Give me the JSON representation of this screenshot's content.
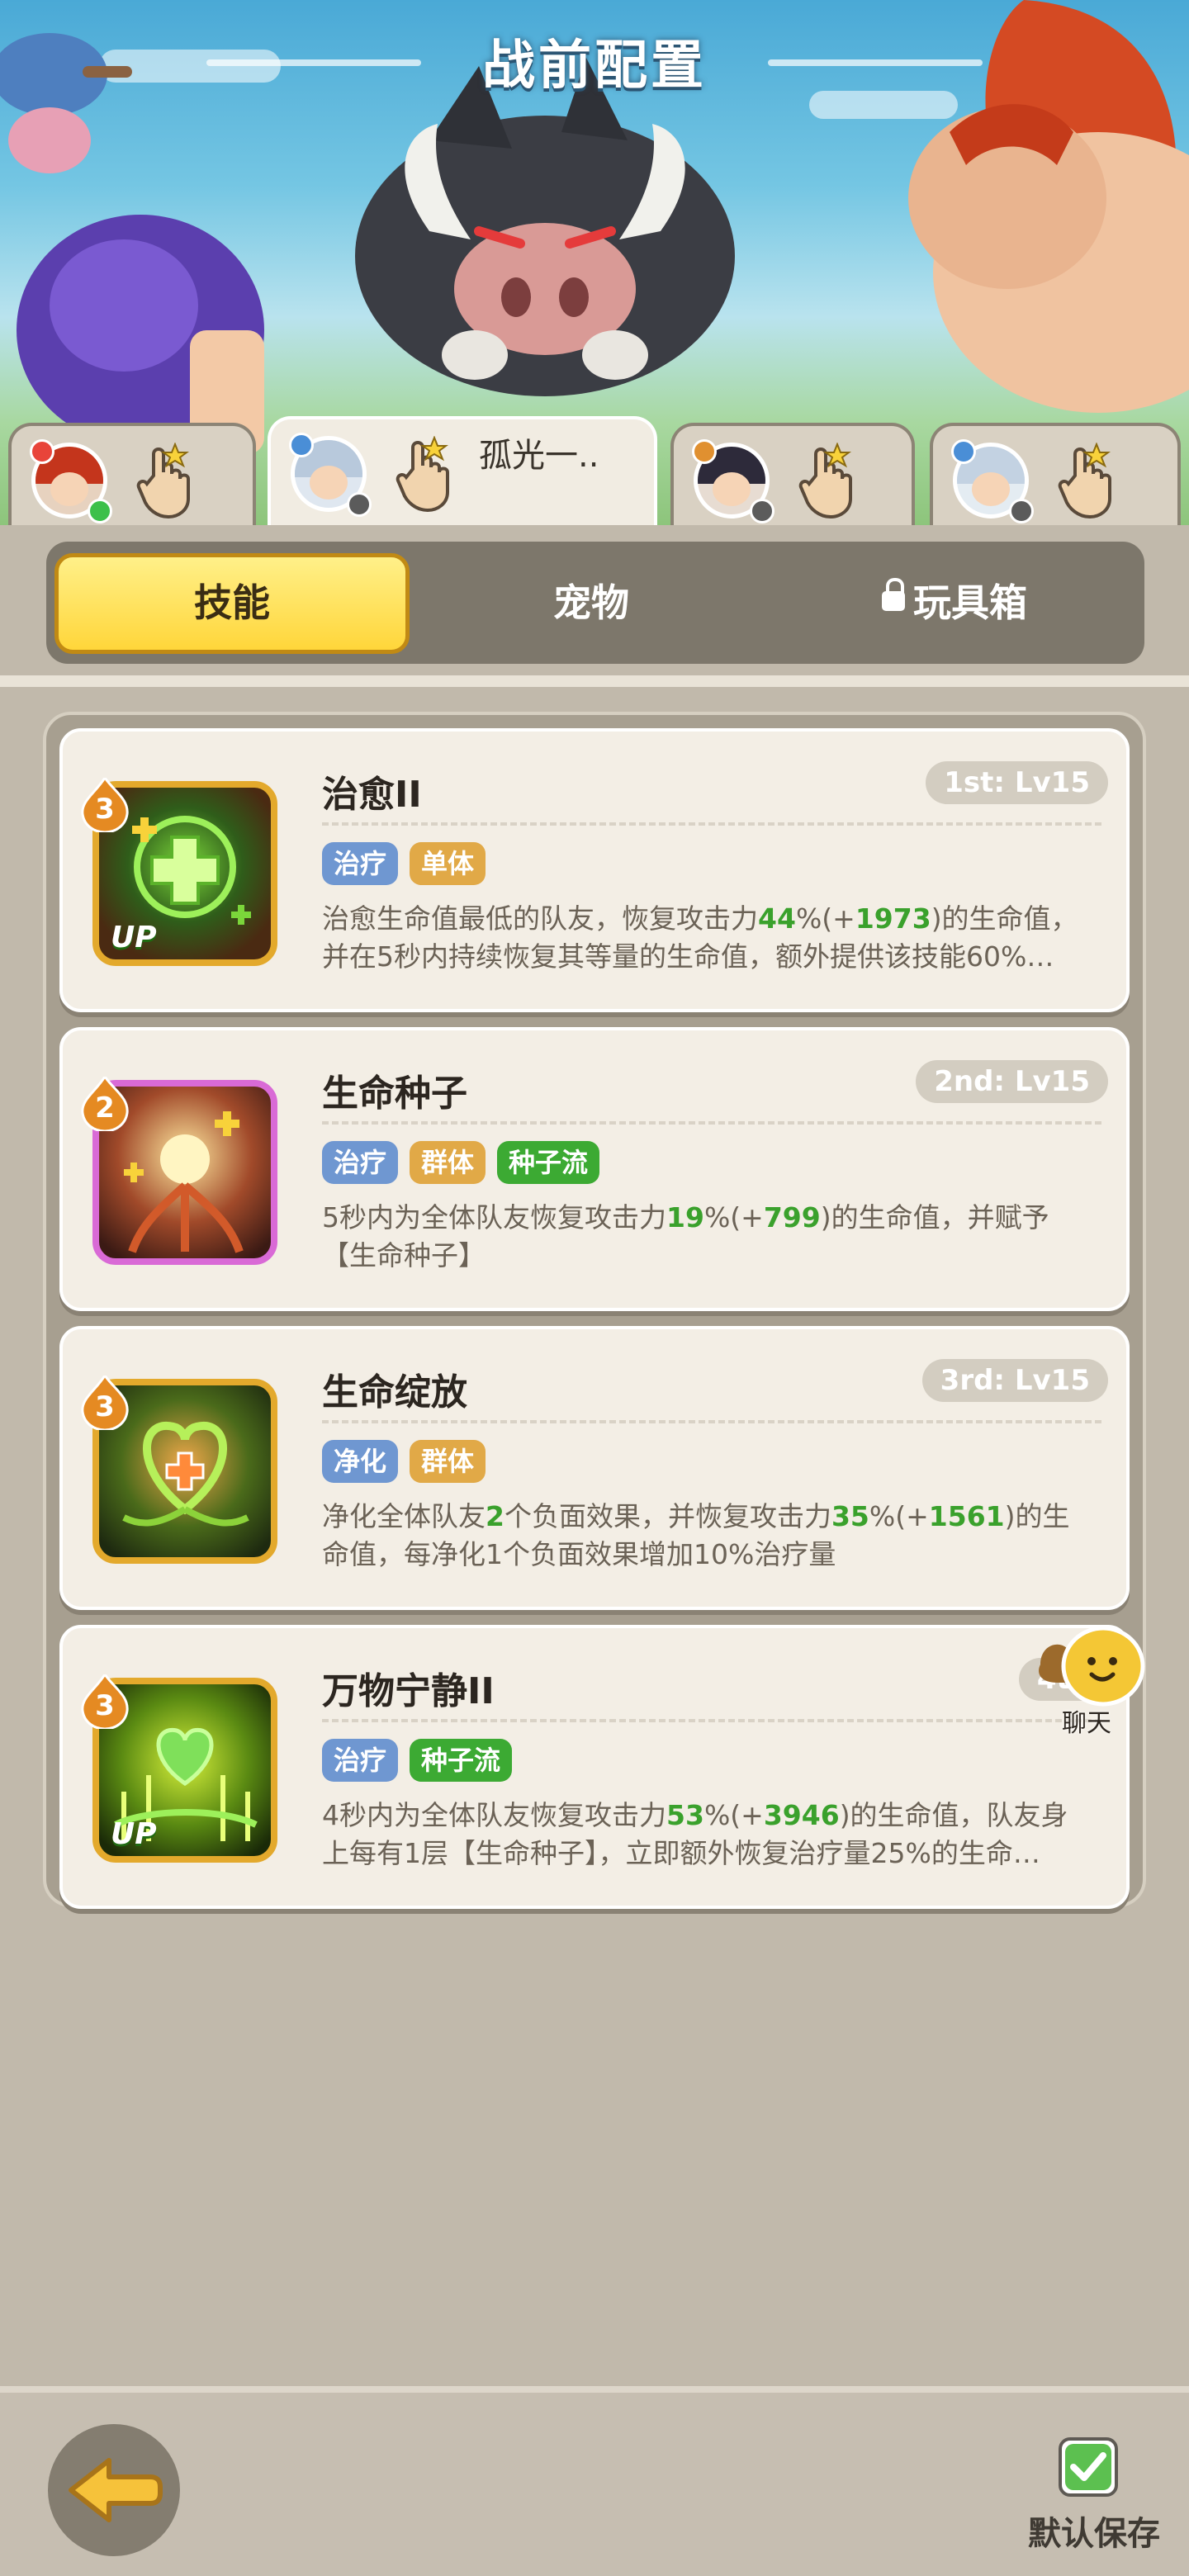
{
  "header": {
    "title": "战前配置"
  },
  "hero_tabs": [
    {
      "name": "",
      "badge_color": "#e8443a"
    },
    {
      "name": "孤光一..",
      "badge_color": "#4a8ed6"
    },
    {
      "name": "",
      "badge_color": "#e09030"
    },
    {
      "name": "",
      "badge_color": "#4a8ed6"
    }
  ],
  "tabs": {
    "skills": "技能",
    "pets": "宠物",
    "toybox": "玩具箱"
  },
  "skills": [
    {
      "rank": "3",
      "name": "治愈II",
      "level": "1st: Lv15",
      "up": "UP",
      "tags": [
        "治疗",
        "单体"
      ],
      "desc_a": "治愈生命值最低的队友，恢复攻击力",
      "desc_b": "44",
      "desc_c": "%(+",
      "desc_d": "1973",
      "desc_e": ")的生命值，并在5秒内持续恢复其等量的生命值，额外提供该技能60%…"
    },
    {
      "rank": "2",
      "name": "生命种子",
      "level": "2nd: Lv15",
      "tags": [
        "治疗",
        "群体",
        "种子流"
      ],
      "desc_a": "5秒内为全体队友恢复攻击力",
      "desc_b": "19",
      "desc_c": "%(+",
      "desc_d": "799",
      "desc_e": ")的生命值，并赋予【生命种子】"
    },
    {
      "rank": "3",
      "name": "生命绽放",
      "level": "3rd: Lv15",
      "tags": [
        "净化",
        "群体"
      ],
      "desc_a": "净化全体队友",
      "desc_b": "2",
      "desc_c": "个负面效果，并恢复攻击力",
      "desc_d": "35",
      "desc_e": "%(+",
      "desc_f": "1561",
      "desc_g": ")的生命值，每净化1个负面效果增加10%治疗量"
    },
    {
      "rank": "3",
      "name": "万物宁静II",
      "level": "4th",
      "up": "UP",
      "tags": [
        "治疗",
        "种子流"
      ],
      "desc_a": "4秒内为全体队友恢复攻击力",
      "desc_b": "53",
      "desc_c": "%(+",
      "desc_d": "3946",
      "desc_e": ")的生命值，队友身上每有1层【生命种子】，立即额外恢复治疗量25%的生命…"
    }
  ],
  "chat": {
    "label": "聊天"
  },
  "footer": {
    "save_label": "默认保存"
  }
}
